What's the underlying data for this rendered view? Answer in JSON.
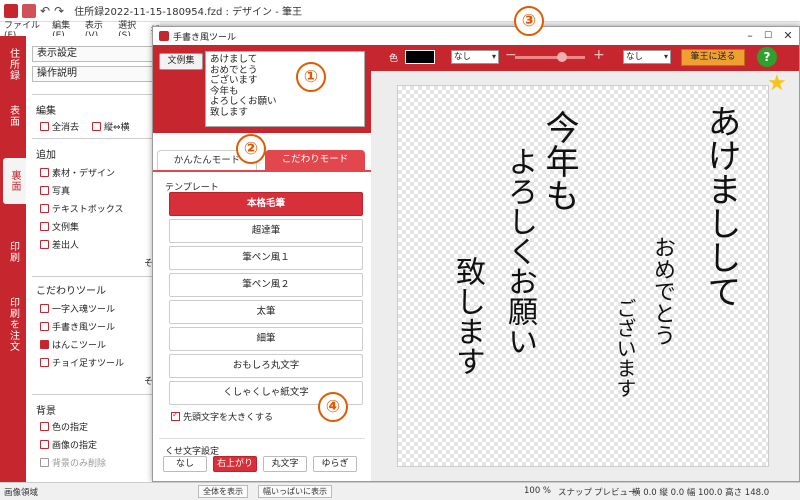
{
  "main": {
    "title": "住所録2022-11-15-180954.fzd : デザイン - 筆王",
    "menu": [
      "ファイル(F)",
      "編集(E)",
      "表示(V)",
      "選択(S)",
      "挿"
    ]
  },
  "vtabs": [
    "住所録",
    "表面",
    "裏面",
    "印刷",
    "印刷を注文"
  ],
  "leftpanel": {
    "display_settings": "表示設定",
    "operation_help": "操作説明",
    "edit_head": "編集",
    "clear_all": "全消去",
    "orientation": "縦⇔横",
    "add_head": "追加",
    "add_items": [
      "素材・デザイン",
      "写真",
      "テキストボックス",
      "文例集",
      "差出人"
    ],
    "more1": "そ",
    "tools_head": "こだわりツール",
    "tool_items": [
      "一字入魂ツール",
      "手書き風ツール",
      "はんこツール",
      "チョイ足すツール"
    ],
    "more2": "そ",
    "bg_head": "背景",
    "bg_items": [
      "色の指定",
      "画像の指定",
      "背景のみ削除"
    ]
  },
  "dialog": {
    "title": "手書き風ツール",
    "sample_button": "文例集",
    "text_value": "あけまして\nおめでとう\nございます\n今年も\nよろしくお願い\n致します",
    "mode_easy": "かんたんモード",
    "mode_pro": "こだわりモード",
    "template_label": "テンプレート",
    "templates": [
      "本格毛筆",
      "超達筆",
      "筆ペン風１",
      "筆ペン風２",
      "太筆",
      "細筆",
      "おもしろ丸文字",
      "くしゃくしゃ紙文字"
    ],
    "selected_template": "本格毛筆",
    "big_first_label": "先頭文字を大きくする",
    "big_first_checked": true,
    "quirk_label": "くせ文字設定",
    "quirks": [
      "なし",
      "右上がり",
      "丸文字",
      "ゆらぎ"
    ],
    "selected_quirk": "右上がり"
  },
  "toolbar": {
    "color_label": "色",
    "color_value": "#000000",
    "select1": "なし",
    "minus": "−",
    "plus": "+",
    "select2": "なし",
    "send_button": "筆王に送る",
    "help": "?"
  },
  "canvas_text": {
    "col1": "あけましして",
    "col2": "おめでとう",
    "col3": "ございます",
    "col4": "今年も",
    "col5": "よろしくお願い",
    "col6": "致します"
  },
  "statusbar": {
    "area": "画像領域",
    "show_all": "全体を表示",
    "fit_width": "幅いっぱいに表示",
    "zoom": "100 %",
    "snap": "スナップ",
    "preview": "プレビュー",
    "coords": "横 0.0 縦 0.0 幅 100.0 高さ 148.0"
  },
  "annotations": [
    "①",
    "②",
    "③",
    "④"
  ],
  "colors": {
    "accent": "#c6262e",
    "send": "#f0a030",
    "help": "#2ea02e",
    "annotation": "#e05a00"
  }
}
